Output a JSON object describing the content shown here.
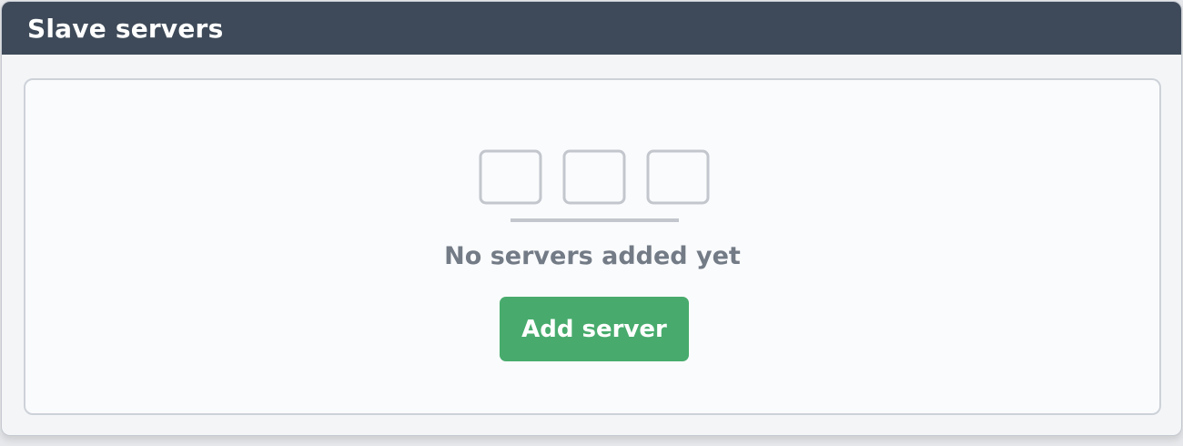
{
  "panel": {
    "title": "Slave servers"
  },
  "empty_state": {
    "illustration_icon": "server-boxes-icon",
    "message": "No servers added yet",
    "add_button_label": "Add server"
  },
  "colors": {
    "header_bg": "#3e4a59",
    "accent_green": "#48ab6d",
    "muted_text": "#737b86",
    "icon_stroke": "#c3c7cd"
  }
}
